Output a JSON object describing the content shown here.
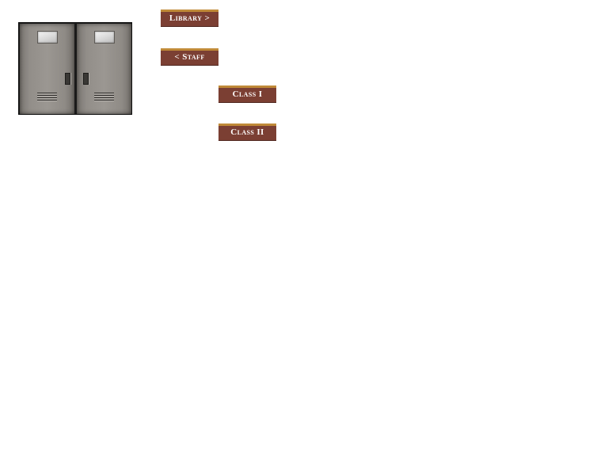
{
  "image": {
    "alt": "Lockers",
    "icon": "lockers-image"
  },
  "nav": {
    "library": "Library >",
    "staff": "< Staff",
    "class1": "Class I",
    "class2": "Class II"
  },
  "colors": {
    "button_bg": "#7b3f33",
    "button_top_border": "#c08a38",
    "button_text": "#ffffff",
    "page_bg": "#ffffff"
  }
}
